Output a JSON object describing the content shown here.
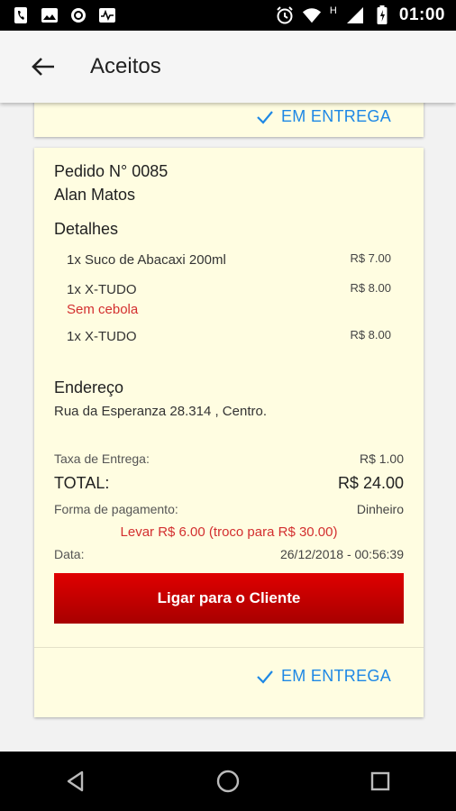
{
  "status_bar": {
    "time": "01:00",
    "left_icons": [
      "phone-icon",
      "image-icon",
      "circle-icon",
      "activity-icon"
    ],
    "right_icons": [
      "alarm-icon",
      "wifi-icon",
      "signal-icon",
      "battery-icon"
    ],
    "network_letter": "H"
  },
  "app_bar": {
    "title": "Aceitos"
  },
  "previous_card": {
    "status_label": "EM ENTREGA"
  },
  "order": {
    "number": "Pedido N° 0085",
    "customer": "Alan Matos",
    "details_title": "Detalhes",
    "items": [
      {
        "name": "1x Suco de Abacaxi 200ml",
        "price": "R$ 7.00",
        "note": ""
      },
      {
        "name": "1x X-TUDO",
        "price": "R$ 8.00",
        "note": "Sem cebola"
      },
      {
        "name": "1x X-TUDO",
        "price": "R$ 8.00",
        "note": ""
      }
    ],
    "address_title": "Endereço",
    "address": "Rua da Esperanza 28.314 , Centro.",
    "delivery_fee_label": "Taxa de Entrega:",
    "delivery_fee": "R$ 1.00",
    "total_label": "TOTAL:",
    "total": "R$ 24.00",
    "payment_label": "Forma de pagamento:",
    "payment_method": "Dinheiro",
    "change_note": "Levar R$ 6.00 (troco para R$ 30.00)",
    "date_label": "Data:",
    "date": "26/12/2018 - 00:56:39",
    "call_button": "Ligar para o Cliente",
    "status_label": "EM ENTREGA"
  },
  "colors": {
    "card_bg": "#fffde1",
    "accent_blue": "#1e88e5",
    "alert_red": "#d32f2f",
    "button_red": "#d00000"
  }
}
